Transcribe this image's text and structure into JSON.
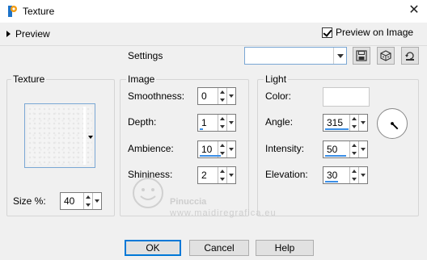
{
  "window": {
    "title": "Texture",
    "close_glyph": "✕"
  },
  "preview": {
    "toggle_label": "Preview",
    "preview_on_image_label": "Preview on Image",
    "preview_on_image_checked": true
  },
  "settings": {
    "label": "Settings",
    "combo_value": "",
    "icons": [
      "save-preset-icon",
      "preset-dice-icon",
      "reset-icon"
    ]
  },
  "texture_group": {
    "label": "Texture",
    "size_label": "Size %:",
    "size_value": "40"
  },
  "image_group": {
    "label": "Image",
    "fields": [
      {
        "label": "Smoothness:",
        "value": "0"
      },
      {
        "label": "Depth:",
        "value": "1"
      },
      {
        "label": "Ambience:",
        "value": "10"
      },
      {
        "label": "Shininess:",
        "value": "2"
      }
    ]
  },
  "light_group": {
    "label": "Light",
    "color_label": "Color:",
    "color_value": "#ffffff",
    "fields": [
      {
        "label": "Angle:",
        "value": "315"
      },
      {
        "label": "Intensity:",
        "value": "50"
      },
      {
        "label": "Elevation:",
        "value": "30"
      }
    ],
    "angle_degrees": 315
  },
  "watermark": {
    "name": "Pinuccia",
    "url": "www.maidiregrafica.eu"
  },
  "buttons": {
    "ok": "OK",
    "cancel": "Cancel",
    "help": "Help"
  },
  "colors": {
    "accent": "#0078d7",
    "slider": "#3a8ee6"
  }
}
